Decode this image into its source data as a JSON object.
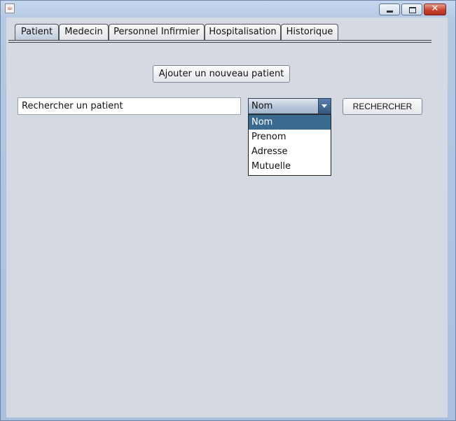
{
  "window": {
    "controls": {
      "close_symbol": "✕"
    },
    "icon": "java-cup-icon"
  },
  "tabs": [
    {
      "label": "Patient",
      "active": true
    },
    {
      "label": "Medecin",
      "active": false
    },
    {
      "label": "Personnel Infirmier",
      "active": false
    },
    {
      "label": "Hospitalisation",
      "active": false
    },
    {
      "label": "Historique",
      "active": false
    }
  ],
  "patient": {
    "add_button_label": "Ajouter un nouveau patient",
    "search_input_value": "Rechercher un patient",
    "criteria_selected": "Nom",
    "criteria_options": [
      "Nom",
      "Prenom",
      "Adresse",
      "Mutuelle"
    ],
    "search_button_label": "RECHERCHER"
  },
  "colors": {
    "selection": "#3b6a91",
    "panel": "#d5d9e2",
    "titlebar": "#b3c8e3"
  }
}
